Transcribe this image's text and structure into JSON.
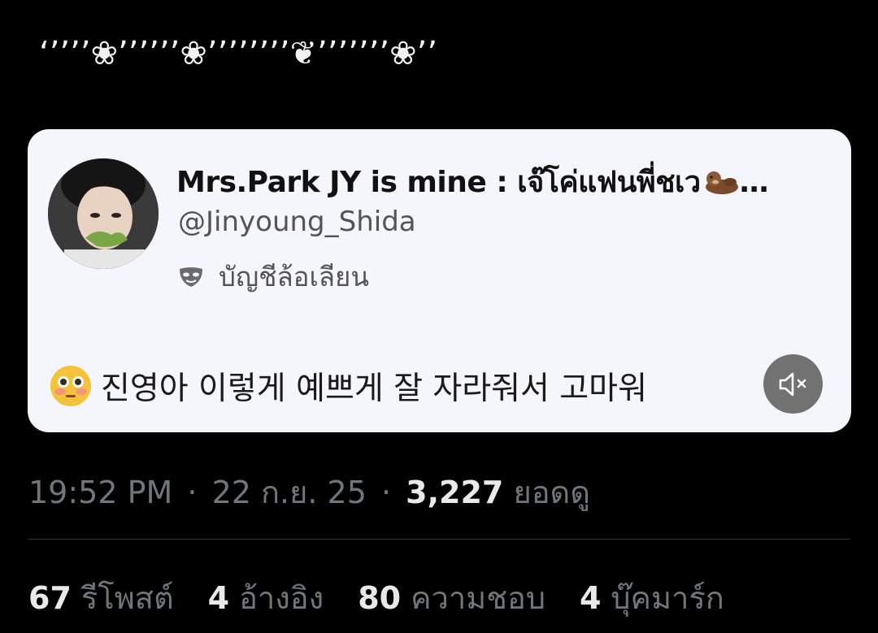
{
  "tweet": {
    "caption": "‘’’’’❀’’’’’’❀’’’’’’’’❦’’’’’’’❀’’"
  },
  "quoted_media": {
    "display_name": "Mrs.Park JY is mine : เจ๊โค่แฟนพี่ชเว",
    "name_ellipsis": "…",
    "handle": "@Jinyoung_Shida",
    "account_label": "บัญชีล้อเลียน",
    "body_text": "진영아 이렇게 예쁘게 잘 자라줘서 고마워",
    "icons": {
      "label_icon": "parody-mask-icon",
      "body_emoji": "flushed-face-emoji",
      "name_emoji": "otter-emoji",
      "media_control": "mute-icon"
    }
  },
  "meta": {
    "time": "19:52 PM",
    "separator": "·",
    "date": "22 ก.ย. 25",
    "views_count": "3,227",
    "views_label": "ยอดดู"
  },
  "stats": [
    {
      "count": "67",
      "label": "รีโพสต์"
    },
    {
      "count": "4",
      "label": "อ้างอิง"
    },
    {
      "count": "80",
      "label": "ความชอบ"
    },
    {
      "count": "4",
      "label": "บุ๊คมาร์ก"
    }
  ],
  "colors": {
    "background": "#000000",
    "primary_text": "#e7e9ea",
    "secondary_text": "#71767b",
    "divider": "#2f3336",
    "media_card": "#f4f6fb"
  }
}
